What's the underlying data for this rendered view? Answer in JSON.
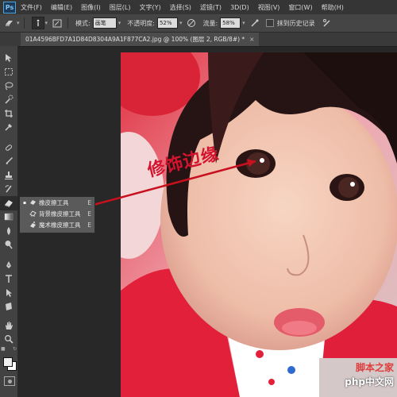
{
  "app": {
    "logo": "Ps"
  },
  "menu": [
    "文件(F)",
    "编辑(E)",
    "图像(I)",
    "图层(L)",
    "文字(Y)",
    "选择(S)",
    "滤镜(T)",
    "3D(D)",
    "视图(V)",
    "窗口(W)",
    "帮助(H)"
  ],
  "options": {
    "mode_label": "模式:",
    "mode_value": "画笔",
    "opacity_label": "不透明度:",
    "opacity_value": "52%",
    "flow_label": "流量:",
    "flow_value": "58%",
    "erase_history_label": "抹到历史记录"
  },
  "document": {
    "tab_title": "01A4596BFD7A1D84D8304A9A1F877CA2.jpg @ 100% (图层 2, RGB/8#) *",
    "close_glyph": "×"
  },
  "flyout": [
    {
      "label": "橡皮擦工具",
      "key": "E",
      "selected": true,
      "icon": "eraser-icon"
    },
    {
      "label": "背景橡皮擦工具",
      "key": "E",
      "selected": false,
      "icon": "background-eraser-icon"
    },
    {
      "label": "魔术橡皮擦工具",
      "key": "E",
      "selected": false,
      "icon": "magic-eraser-icon"
    }
  ],
  "annotation": {
    "text": "修饰边缘",
    "color": "#d4142e"
  },
  "watermark": {
    "line1": "脚本之家",
    "line2": "php中文网"
  },
  "tools": [
    "move-tool-icon",
    "marquee-tool-icon",
    "lasso-tool-icon",
    "quick-select-tool-icon",
    "crop-tool-icon",
    "eyedropper-tool-icon",
    "healing-brush-tool-icon",
    "brush-tool-icon",
    "clone-stamp-tool-icon",
    "history-brush-tool-icon",
    "eraser-tool-icon",
    "gradient-tool-icon",
    "blur-tool-icon",
    "dodge-tool-icon",
    "pen-tool-icon",
    "type-tool-icon",
    "path-select-tool-icon",
    "rectangle-tool-icon",
    "hand-tool-icon",
    "zoom-tool-icon"
  ]
}
